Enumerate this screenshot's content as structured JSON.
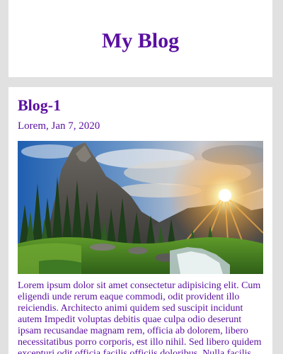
{
  "header": {
    "title": "My Blog"
  },
  "post": {
    "title": "Blog-1",
    "meta": "Lorem, Jan 7, 2020",
    "image_alt": "mountain-landscape-photo",
    "body": "Lorem ipsum dolor sit amet consectetur adipisicing elit. Cum eligendi unde rerum eaque commodi, odit provident illo reiciendis. Architecto animi quidem sed suscipit incidunt autem Impedit voluptas debitis quae culpa odio deserunt ipsam recusandae magnam rem, officia ab dolorem, libero necessitatibus porro corporis, est illo nihil. Sed libero quidem excepturi odit officia facilis officiis doloribus. Nulla facilis"
  },
  "colors": {
    "background": "#e1e1e1",
    "card": "#ffffff",
    "accent": "#5a0fa0"
  }
}
